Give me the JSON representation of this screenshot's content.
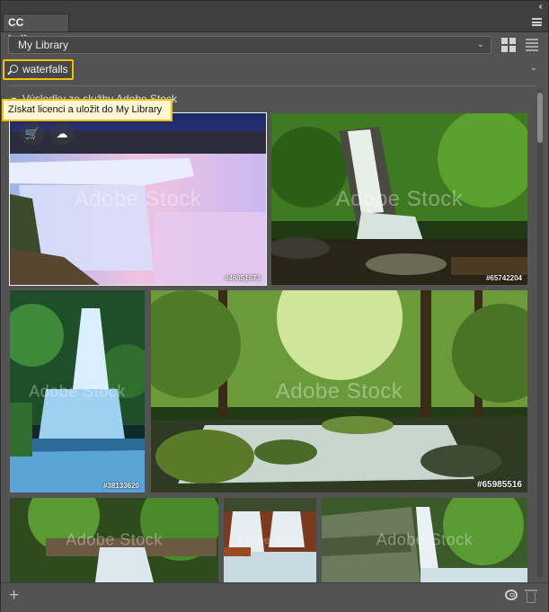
{
  "panel": {
    "tab_label": "CC knihovny"
  },
  "library": {
    "selected": "My Library"
  },
  "search": {
    "value": "waterfalls"
  },
  "section": {
    "title": "Výsledky ze služby Adobe Stock"
  },
  "tooltip": {
    "text": "Získat licenci a uložit do My Library"
  },
  "watermark": "Adobe Stock",
  "images": [
    {
      "id": "#46851673"
    },
    {
      "id": "#65742204"
    },
    {
      "id": "#38133620"
    },
    {
      "id": "#65985516"
    },
    {
      "id": ""
    },
    {
      "id": ""
    },
    {
      "id": ""
    }
  ],
  "colors": {
    "panel_bg": "#535353",
    "highlight": "#f2c200",
    "tooltip_bg": "#fff7d6"
  },
  "icons": [
    "collapse-icon",
    "panel-menu-icon",
    "chevron-down-icon",
    "grid-view-icon",
    "list-view-icon",
    "search-icon",
    "cart-icon",
    "cloud-download-icon",
    "add-icon",
    "creative-cloud-icon",
    "trash-icon"
  ]
}
